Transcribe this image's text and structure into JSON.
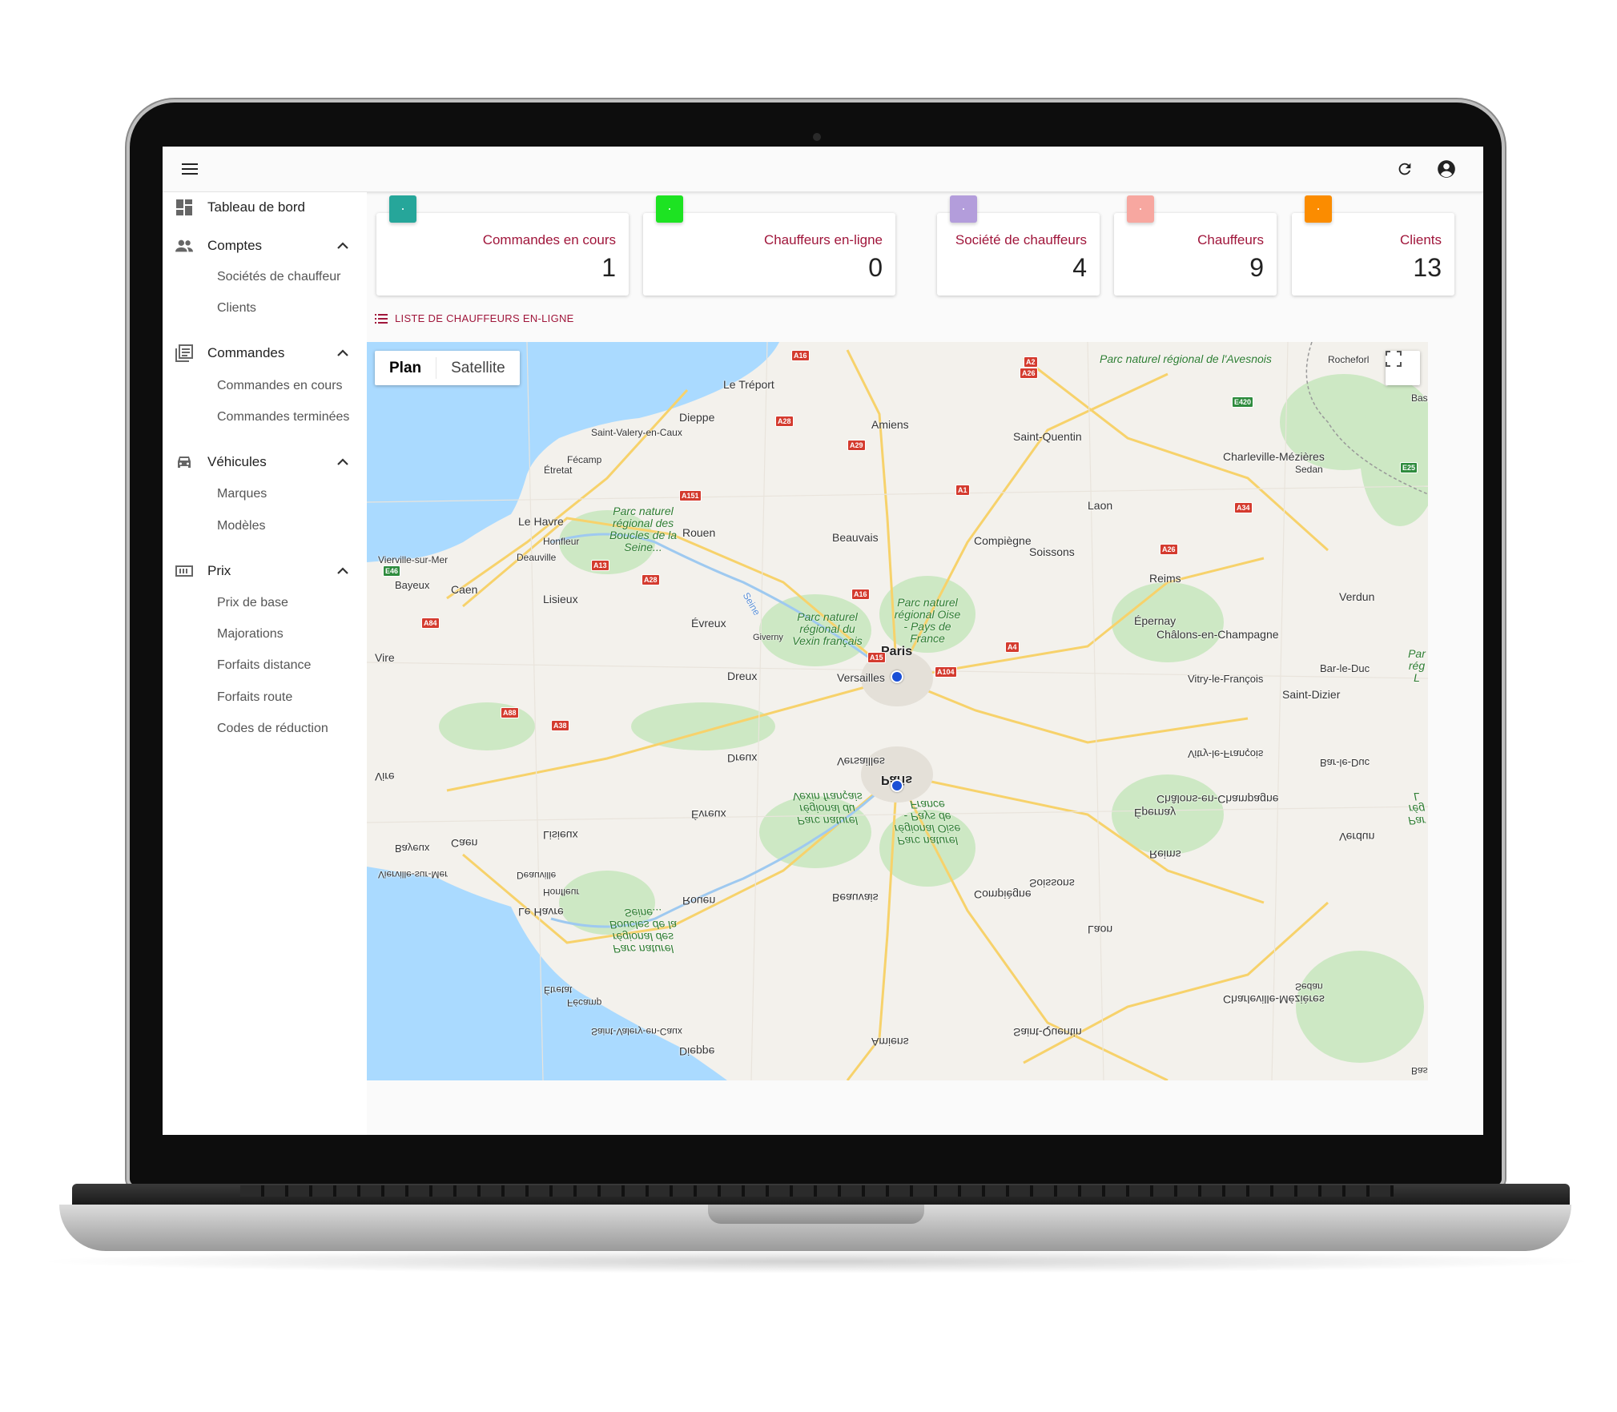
{
  "topbar": {
    "menu_icon": "hamburger-menu-icon",
    "refresh_icon": "refresh-icon",
    "account_icon": "account-circle-icon"
  },
  "sidebar": {
    "items": [
      {
        "label": "Tableau de bord",
        "icon": "dashboard-icon"
      },
      {
        "label": "Comptes",
        "icon": "people-icon",
        "expanded": true,
        "children": [
          "Sociétés de chauffeur",
          "Clients"
        ]
      },
      {
        "label": "Commandes",
        "icon": "list-box-icon",
        "expanded": true,
        "children": [
          "Commandes en cours",
          "Commandes terminées"
        ]
      },
      {
        "label": "Véhicules",
        "icon": "car-icon",
        "expanded": true,
        "children": [
          "Marques",
          "Modèles"
        ]
      },
      {
        "label": "Prix",
        "icon": "pricing-icon",
        "expanded": true,
        "children": [
          "Prix de base",
          "Majorations",
          "Forfaits distance",
          "Forfaits route",
          "Codes de réduction"
        ]
      }
    ]
  },
  "cards": [
    {
      "title": "Commandes en cours",
      "value": "1",
      "color": "#26a69a"
    },
    {
      "title": "Chauffeurs en-ligne",
      "value": "0",
      "color": "#1de322"
    },
    {
      "title": "Société de chauffeurs",
      "value": "4",
      "color": "#b39ddb"
    },
    {
      "title": "Chauffeurs",
      "value": "9",
      "color": "#f7a7a0"
    },
    {
      "title": "Clients",
      "value": "13",
      "color": "#fb8c00"
    }
  ],
  "online_list_link": "LISTE DE CHAUFFEURS EN-LIGNE",
  "map": {
    "type_buttons": [
      "Plan",
      "Satellite"
    ],
    "active_type": "Plan",
    "fullscreen_icon": "fullscreen-icon",
    "cities": [
      "Le Tréport",
      "Dieppe",
      "Amiens",
      "Saint-Quentin",
      "Rocheforl",
      "Saint-Valery-en-Caux",
      "Fécamp",
      "Étretat",
      "Charleville-Mézières",
      "Sedan",
      "Le Havre",
      "Honfleur",
      "Rouen",
      "Beauvais",
      "Compiègne",
      "Soissons",
      "Laon",
      "Deauville",
      "Vierville-sur-Mer",
      "Bayeux",
      "Caen",
      "Lisieux",
      "Évreux",
      "Giverny",
      "Reims",
      "Verdun",
      "Épernay",
      "Châlons-en-Champagne",
      "Paris",
      "Versailles",
      "Dreux",
      "Vire",
      "Vitry-le-François",
      "Saint-Dizier",
      "Bar-le-Duc",
      "Bas"
    ],
    "parks": [
      "Parc naturel régional de l'Avesnois",
      "Parc naturel régional des Boucles de la Seine...",
      "Parc naturel régional du Vexin français",
      "Parc naturel régional Oise - Pays de France",
      "Par rég L"
    ],
    "roads": [
      "A16",
      "A2",
      "A26",
      "A28",
      "A29",
      "E420",
      "A151",
      "A1",
      "A34",
      "A13",
      "E46",
      "A84",
      "A28",
      "A16",
      "A4",
      "A15",
      "A104",
      "A88",
      "A38",
      "A26",
      "E25",
      "Seine"
    ],
    "mirrored_cities": [
      "Versailles",
      "Dreux",
      "Paris",
      "Évreux",
      "Vire",
      "Caen",
      "Lisieux",
      "Bayeux",
      "Vierville-sur-Mer",
      "Deauville",
      "Honfleur",
      "Le Havre",
      "Rouen",
      "Beauvais",
      "Compiègne",
      "Soissons",
      "Laon",
      "Reims",
      "Verdun",
      "Épernay",
      "Châlons-en-Champagne",
      "Vitry-le-François",
      "Bar-le-Duc",
      "Étretat",
      "Fécamp",
      "Saint-Valery-en-Caux",
      "Dieppe",
      "Amiens",
      "Saint-Quentin",
      "Sedan",
      "Charleville-Mézières",
      "Bas"
    ],
    "mirrored_parks": [
      "Parc naturel régional du Vexin français",
      "Parc naturel régional Oise - Pays de France",
      "Parc naturel régional des Boucles de la Seine...",
      "Par rég L"
    ]
  }
}
